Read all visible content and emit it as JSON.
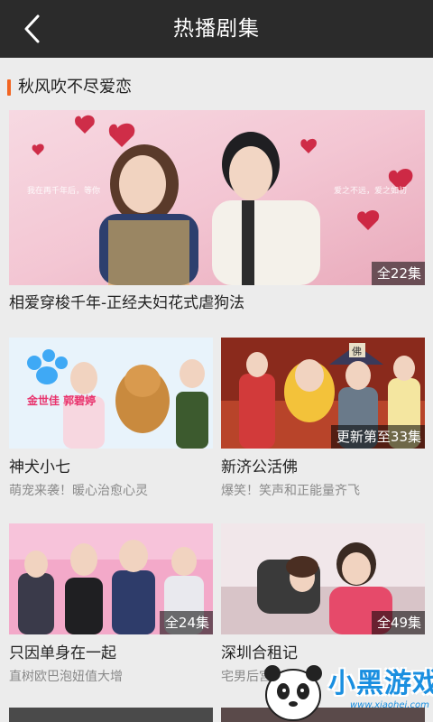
{
  "header": {
    "title": "热播剧集"
  },
  "section": {
    "title": "秋风吹不尽爱恋"
  },
  "featured": {
    "title": "相爱穿梭千年-正经夫妇花式虐狗法",
    "badge": "全22集",
    "poster_text_left": "我在再千年后，等你",
    "poster_text_right": "爱之不远，爱之如初"
  },
  "items": [
    {
      "title": "神犬小七",
      "subtitle": "萌宠来袭！暖心治愈心灵",
      "badge": "",
      "poster_text": "金世佳 郭碧婷"
    },
    {
      "title": "新济公活佛",
      "subtitle": "爆笑！笑声和正能量齐飞",
      "badge": "更新第至33集",
      "poster_text": "佛"
    },
    {
      "title": "只因单身在一起",
      "subtitle": "直树欧巴泡妞值大增",
      "badge": "全24集",
      "poster_text": ""
    },
    {
      "title": "深圳合租记",
      "subtitle": "宅男后宫",
      "badge": "全49集",
      "poster_text": ""
    }
  ],
  "watermark": {
    "brand": "小黑游戏",
    "url": "www.xiaohei.com"
  },
  "colors": {
    "accent": "#f26522",
    "topbar": "#2b2b2b",
    "background": "#ececec"
  }
}
